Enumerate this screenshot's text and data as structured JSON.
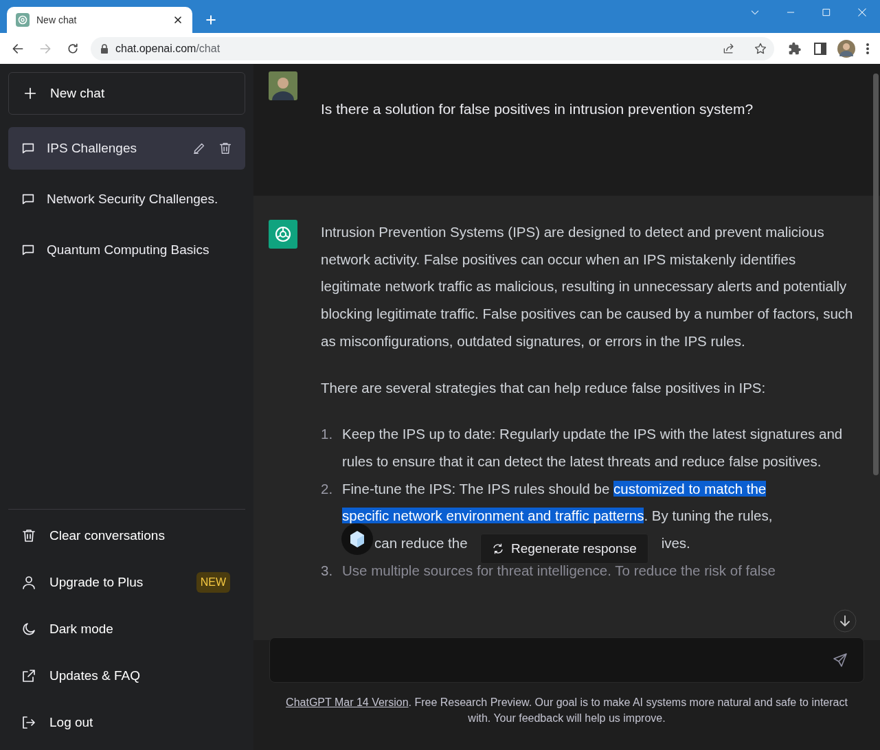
{
  "browser": {
    "tab_title": "New chat",
    "url_host": "chat.openai.com",
    "url_path": "/chat"
  },
  "sidebar": {
    "new_chat": "New chat",
    "conversations": [
      {
        "title": "IPS Challenges",
        "selected": true
      },
      {
        "title": "Network Security Challenges.",
        "selected": false
      },
      {
        "title": "Quantum Computing Basics",
        "selected": false
      }
    ],
    "menu": [
      {
        "kind": "trash",
        "label": "Clear conversations"
      },
      {
        "kind": "user",
        "label": "Upgrade to Plus",
        "badge": "NEW"
      },
      {
        "kind": "moon",
        "label": "Dark mode"
      },
      {
        "kind": "external",
        "label": "Updates & FAQ"
      },
      {
        "kind": "logout",
        "label": "Log out"
      }
    ]
  },
  "chat": {
    "question": "Is there a solution for false positives in intrusion prevention system?",
    "paragraphs": [
      "Intrusion Prevention Systems (IPS) are designed to detect and prevent malicious network activity. False positives can occur when an IPS mistakenly identifies legitimate network traffic as malicious, resulting in unnecessary alerts and potentially blocking legitimate traffic. False positives can be caused by a number of factors, such as misconfigurations, outdated signatures, or errors in the IPS rules.",
      "There are several strategies that can help reduce false positives in IPS:"
    ],
    "list": [
      {
        "kind": "full",
        "number": "1.",
        "text": "Keep the IPS up to date: Regularly update the IPS with the latest signatures and rules to ensure that it can detect the latest threats and reduce false positives."
      },
      {
        "kind": "covered",
        "number": "2.",
        "lines": [
          [
            {
              "text": "Fine-tune the IPS: The IPS rules should be ",
              "highlighted": false
            },
            {
              "text": "customized to match the",
              "highlighted": true
            }
          ],
          [
            {
              "text": "specific network environment and traffic patterns",
              "highlighted": true
            },
            {
              "text": ". By tuning the rules,",
              "highlighted": false
            }
          ]
        ],
        "fragments": [
          "can reduce the",
          "ives."
        ]
      },
      {
        "kind": "faded",
        "number": "3.",
        "text": "Use multiple sources for threat intelligence. To reduce the risk of false"
      }
    ],
    "regenerate": "Regenerate response"
  },
  "footer": {
    "link": "ChatGPT Mar 14 Version",
    "text": ". Free Research Preview. Our goal is to make AI systems more natural and safe to interact with. Your feedback will help us improve."
  }
}
